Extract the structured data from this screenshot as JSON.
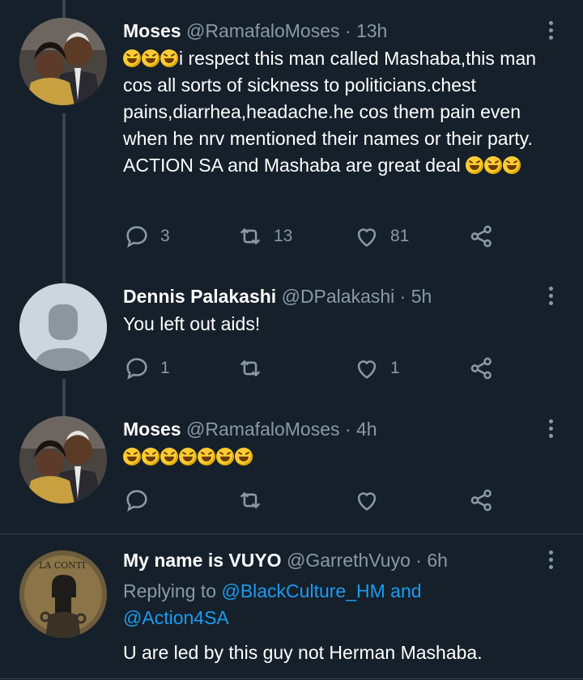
{
  "colors": {
    "background": "#15202b",
    "text": "#ffffff",
    "muted": "#8b98a5",
    "link": "#1d9bf0",
    "border": "#38444d"
  },
  "tweets": [
    {
      "display_name": "Moses",
      "handle": "@RamafaloMoses",
      "time": "· 13h",
      "text": "i respect this man called Mashaba,this man cos all sorts of sickness to politicians.chest pains,diarrhea,headache.he cos them pain even when he nrv mentioned their names or their party. ACTION SA and Mashaba are great deal",
      "lead_emoji_count": 3,
      "trail_emoji_count": 3,
      "emoji_icon": "rolling-on-floor-laughing-emoji",
      "replies": "3",
      "retweets": "13",
      "likes": "81"
    },
    {
      "display_name": "Dennis Palakashi",
      "handle": "@DPalakashi",
      "time": "· 5h",
      "text": "You left out aids!",
      "replies": "1",
      "retweets": "",
      "likes": "1"
    },
    {
      "display_name": "Moses",
      "handle": "@RamafaloMoses",
      "time": "· 4h",
      "text": "",
      "emoji_count": 7,
      "emoji_icon": "rolling-on-floor-laughing-emoji",
      "replies": "",
      "retweets": "",
      "likes": ""
    },
    {
      "display_name": "My name is VUYO",
      "handle": "@GarrethVuyo",
      "time": "· 6h",
      "replying_prefix": "Replying to ",
      "replying_user_1": "@BlackCulture_HM",
      "replying_and": " and",
      "replying_user_2": "@Action4SA",
      "text": "U are led by this guy not Herman Mashaba.",
      "avatar_text": "LA CONTI"
    }
  ]
}
